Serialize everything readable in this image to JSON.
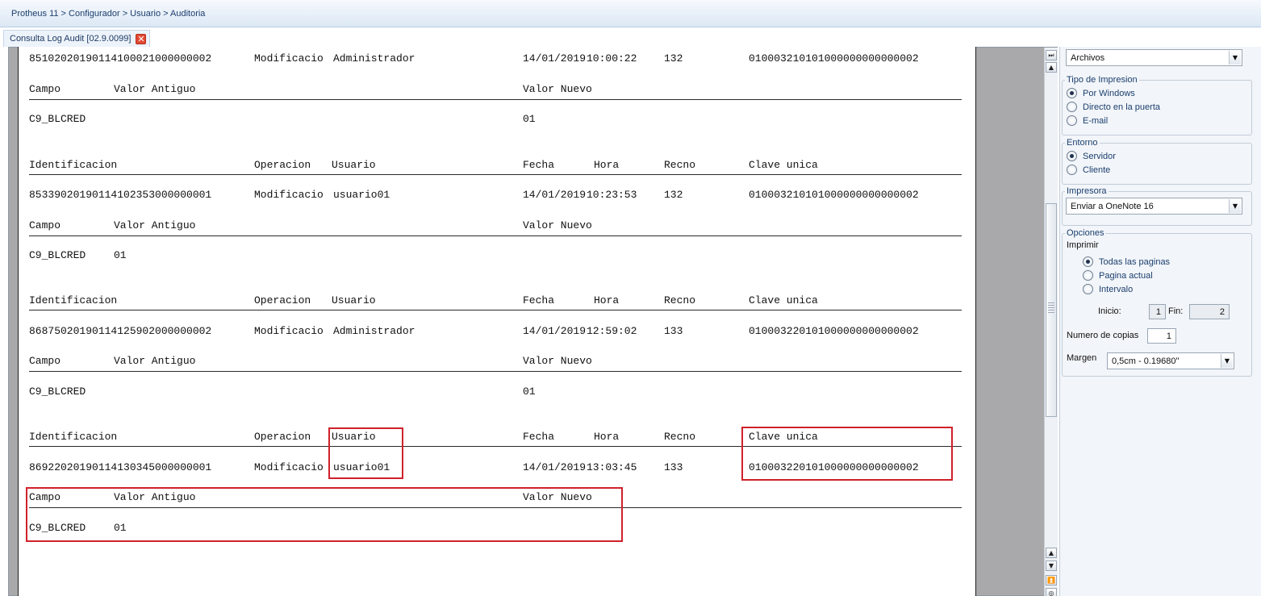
{
  "breadcrumb": "Protheus 11 > Configurador > Usuario > Auditoria",
  "tab": {
    "label": "Consulta Log Audit [02.9.0099]",
    "close_glyph": "✕"
  },
  "report": {
    "header_cols": [
      "Identificacion",
      "Operacion",
      "Usuario",
      "Fecha",
      "Hora",
      "Recno",
      "Clave unica"
    ],
    "detail_cols": [
      "Campo",
      "Valor Antiguo",
      "Valor Nuevo"
    ],
    "records": [
      {
        "id": "85102020190114100021000000002",
        "operacion": "Modificacio",
        "usuario": "Administrador",
        "fecha": "14/01/2019",
        "hora": "10:00:22",
        "recno": "132",
        "clave": "010003210101000000000000002",
        "campo": "C9_BLCRED",
        "antiguo": "",
        "nuevo": "01"
      },
      {
        "id": "85339020190114102353000000001",
        "operacion": "Modificacio",
        "usuario": "usuario01",
        "fecha": "14/01/2019",
        "hora": "10:23:53",
        "recno": "132",
        "clave": "010003210101000000000000002",
        "campo": "C9_BLCRED",
        "antiguo": "01",
        "nuevo": ""
      },
      {
        "id": "86875020190114125902000000002",
        "operacion": "Modificacio",
        "usuario": "Administrador",
        "fecha": "14/01/2019",
        "hora": "12:59:02",
        "recno": "133",
        "clave": "010003220101000000000000002",
        "campo": "C9_BLCRED",
        "antiguo": "",
        "nuevo": "01"
      },
      {
        "id": "86922020190114130345000000001",
        "operacion": "Modificacio",
        "usuario": "usuario01",
        "fecha": "14/01/2019",
        "hora": "13:03:45",
        "recno": "133",
        "clave": "010003220101000000000000002",
        "campo": "C9_BLCRED",
        "antiguo": "01",
        "nuevo": ""
      }
    ]
  },
  "scrollbar": {
    "top_glyph": "⏭",
    "up_glyph": "▲",
    "up2_glyph": "▲",
    "down_glyph": "▼",
    "jump_glyph": "⏫",
    "end_glyph": "◎"
  },
  "panel": {
    "archivos": {
      "value": "Archivos",
      "arrow": "▼"
    },
    "tipo_impresion": {
      "legend": "Tipo de Impresion",
      "options": [
        "Por Windows",
        "Directo en la puerta",
        "E-mail"
      ],
      "selected": 0
    },
    "entorno": {
      "legend": "Entorno",
      "options": [
        "Servidor",
        "Cliente"
      ],
      "selected": 0
    },
    "impresora": {
      "legend": "Impresora",
      "value": "Enviar a OneNote 16",
      "arrow": "▼"
    },
    "opciones": {
      "legend": "Opciones",
      "imprimir_label": "Imprimir",
      "options": [
        "Todas las paginas",
        "Pagina actual",
        "Intervalo"
      ],
      "selected": 0,
      "inicio_label": "Inicio:",
      "inicio_value": "1",
      "fin_label": "Fin:",
      "fin_value": "2",
      "copias_label": "Numero de copias",
      "copias_value": "1",
      "margen_label": "Margen",
      "margen_value": "0,5cm - 0.19680\"",
      "margen_arrow": "▼"
    }
  }
}
